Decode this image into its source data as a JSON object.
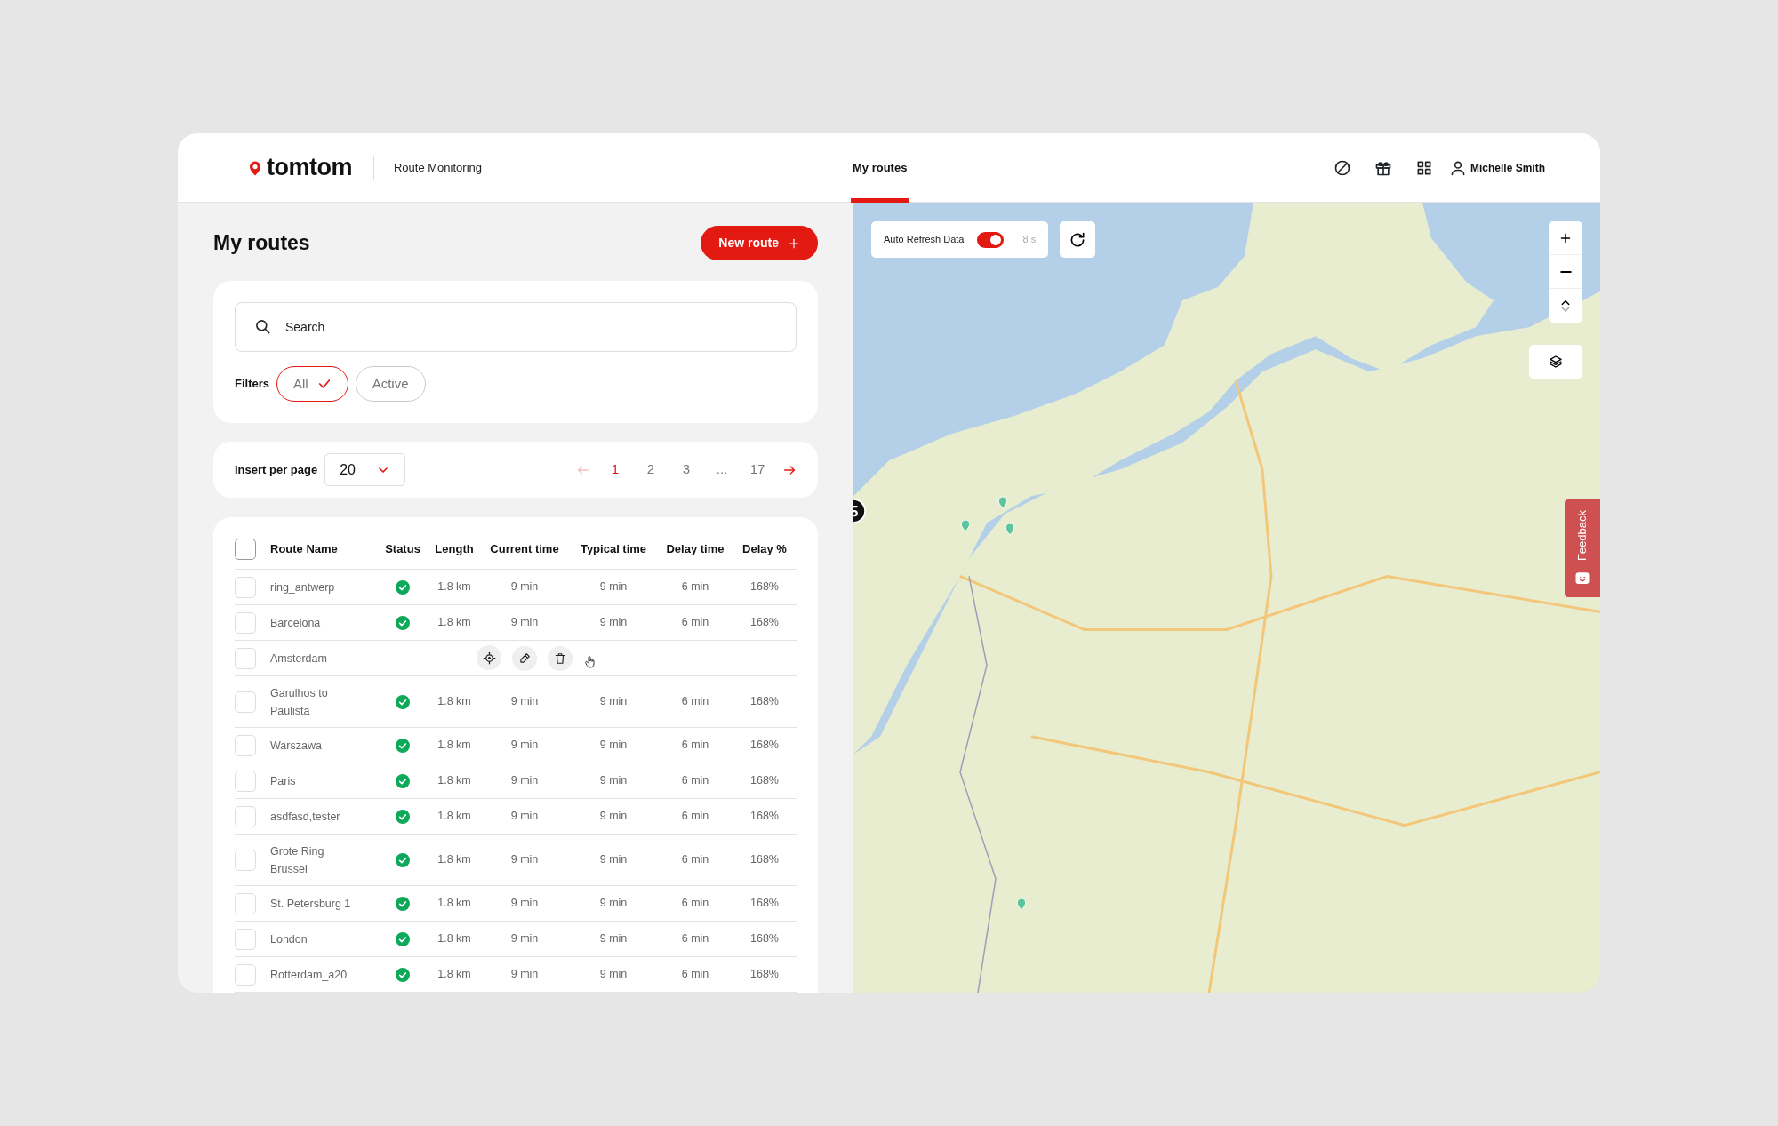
{
  "header": {
    "logo": "tomtom",
    "app_name": "Route Monitoring",
    "nav": [
      {
        "label": "My routes",
        "selected": true
      }
    ],
    "user": "Michelle Smith"
  },
  "page": {
    "title": "My routes",
    "new_button": "New route"
  },
  "search": {
    "placeholder": "Search"
  },
  "filters": {
    "label": "Filters",
    "options": [
      {
        "label": "All",
        "selected": true
      },
      {
        "label": "Active",
        "selected": false
      }
    ]
  },
  "pagination": {
    "per_page_label": "Insert per page",
    "per_page": "20",
    "prev_disabled": true,
    "next_disabled": false,
    "pages": [
      {
        "label": "1",
        "selected": true
      },
      {
        "label": "2",
        "selected": false
      },
      {
        "label": "3",
        "selected": false
      },
      {
        "label": "...",
        "selected": false
      },
      {
        "label": "17",
        "selected": false
      }
    ]
  },
  "table": {
    "select_all_checked": false,
    "columns": [
      "Route Name",
      "Status",
      "Length",
      "Current time",
      "Typical time",
      "Delay time",
      "Delay %"
    ],
    "rows": [
      {
        "name": "ring_antwerp",
        "checked": false,
        "hovered": false,
        "status_ok": true,
        "cells": [
          "1.8 km",
          "9 min",
          "9 min",
          "6 min",
          "168%"
        ]
      },
      {
        "name": "Barcelona",
        "checked": false,
        "hovered": false,
        "status_ok": true,
        "cells": [
          "1.8 km",
          "9 min",
          "9 min",
          "6 min",
          "168%"
        ]
      },
      {
        "name": "Amsterdam",
        "checked": false,
        "hovered": true
      },
      {
        "name": "Garulhos to Paulista",
        "checked": false,
        "hovered": false,
        "status_ok": true,
        "cells": [
          "1.8 km",
          "9 min",
          "9 min",
          "6 min",
          "168%"
        ]
      },
      {
        "name": "Warszawa",
        "checked": false,
        "hovered": false,
        "status_ok": true,
        "cells": [
          "1.8 km",
          "9 min",
          "9 min",
          "6 min",
          "168%"
        ]
      },
      {
        "name": "Paris",
        "checked": false,
        "hovered": false,
        "status_ok": true,
        "cells": [
          "1.8 km",
          "9 min",
          "9 min",
          "6 min",
          "168%"
        ]
      },
      {
        "name": "asdfasd,tester",
        "checked": false,
        "hovered": false,
        "status_ok": true,
        "cells": [
          "1.8 km",
          "9 min",
          "9 min",
          "6 min",
          "168%"
        ]
      },
      {
        "name": "Grote Ring Brussel",
        "checked": false,
        "hovered": false,
        "status_ok": true,
        "cells": [
          "1.8 km",
          "9 min",
          "9 min",
          "6 min",
          "168%"
        ]
      },
      {
        "name": "St. Petersburg 1",
        "checked": false,
        "hovered": false,
        "status_ok": true,
        "cells": [
          "1.8 km",
          "9 min",
          "9 min",
          "6 min",
          "168%"
        ]
      },
      {
        "name": "London",
        "checked": false,
        "hovered": false,
        "status_ok": true,
        "cells": [
          "1.8 km",
          "9 min",
          "9 min",
          "6 min",
          "168%"
        ]
      },
      {
        "name": "Rotterdam_a20",
        "checked": false,
        "hovered": false,
        "status_ok": true,
        "cells": [
          "1.8 km",
          "9 min",
          "9 min",
          "6 min",
          "168%"
        ]
      }
    ]
  },
  "map": {
    "auto_refresh": {
      "label": "Auto Refresh Data",
      "on": true,
      "interval": "8 s"
    },
    "feedback": "Feedback"
  }
}
